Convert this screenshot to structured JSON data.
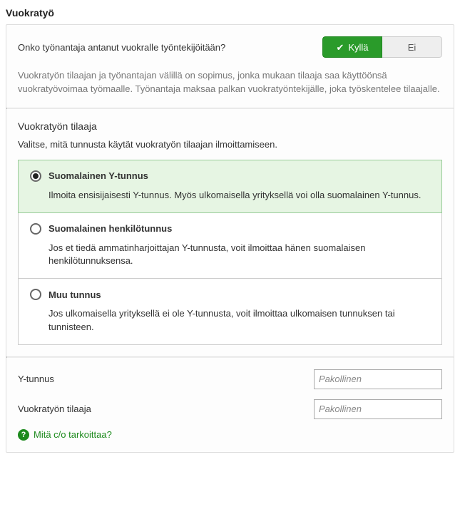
{
  "page": {
    "title": "Vuokratyö"
  },
  "question": {
    "text": "Onko työnantaja antanut vuokralle työntekijöitään?",
    "yes": "Kyllä",
    "no": "Ei"
  },
  "info": {
    "text": "Vuokratyön tilaajan ja työnantajan välillä on sopimus, jonka mukaan tilaaja saa käyttöönsä vuokratyövoimaa työmaalle. Työnantaja maksaa palkan vuokratyöntekijälle, joka työskentelee tilaajalle."
  },
  "tilaaja": {
    "heading": "Vuokratyön tilaaja",
    "desc": "Valitse, mitä tunnusta käytät vuokratyön tilaajan ilmoittamiseen."
  },
  "radios": {
    "opt0": {
      "label": "Suomalainen Y-tunnus",
      "desc": "Ilmoita ensisijaisesti Y-tunnus. Myös ulkomaisella yrityksellä voi olla suomalainen Y-tunnus."
    },
    "opt1": {
      "label": "Suomalainen henkilötunnus",
      "desc": "Jos et tiedä ammatinharjoittajan Y-tunnusta, voit ilmoittaa hänen suomalaisen henkilötunnuksensa."
    },
    "opt2": {
      "label": "Muu tunnus",
      "desc": "Jos ulkomaisella yrityksellä ei ole Y-tunnusta, voit ilmoittaa ulkomaisen tunnuksen tai tunnisteen."
    }
  },
  "fields": {
    "ytunnus": {
      "label": "Y-tunnus",
      "placeholder": "Pakollinen"
    },
    "tilaaja": {
      "label": "Vuokratyön tilaaja",
      "placeholder": "Pakollinen"
    }
  },
  "help_link": {
    "text": "Mitä c/o tarkoittaa?",
    "icon": "?"
  }
}
